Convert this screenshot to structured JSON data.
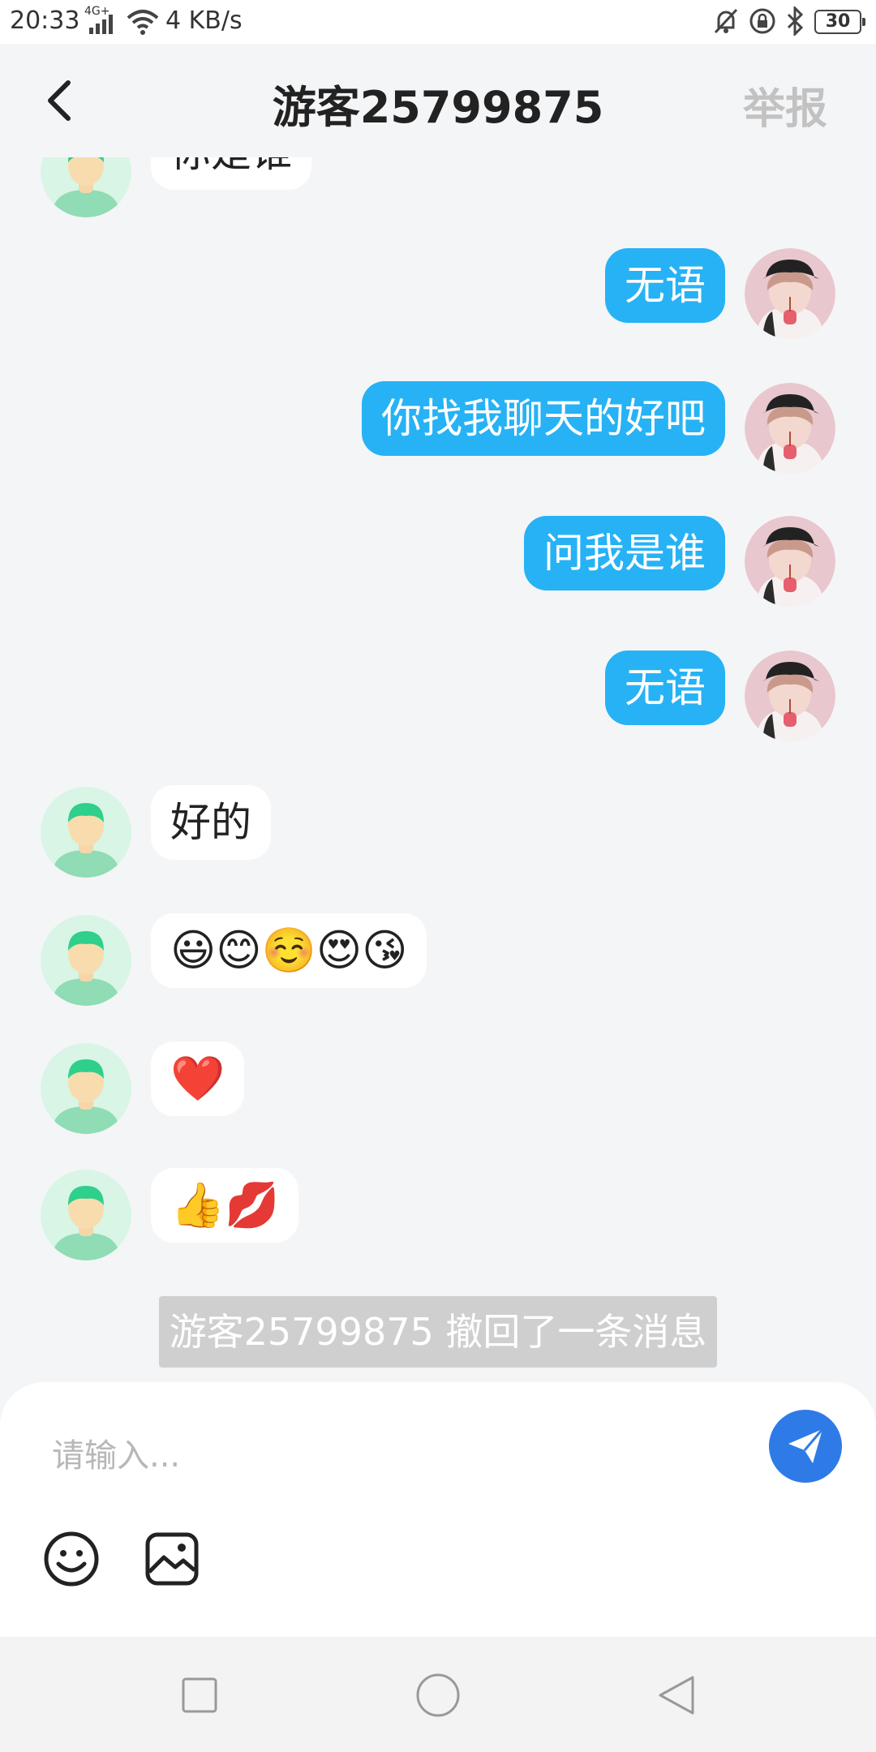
{
  "status_bar": {
    "time": "20:33",
    "network_type": "4G+",
    "speed": "4 KB/s",
    "battery": "30",
    "icons": [
      "signal-icon",
      "wifi-icon",
      "bell-mute-icon",
      "lock-icon",
      "bluetooth-icon",
      "battery-icon"
    ]
  },
  "header": {
    "title": "游客25799875",
    "report_label": "举报",
    "back_icon": "chevron-left-icon"
  },
  "messages": [
    {
      "side": "in",
      "text": "你是谁",
      "partial": true
    },
    {
      "side": "out",
      "text": "无语"
    },
    {
      "side": "out",
      "text": "你找我聊天的好吧"
    },
    {
      "side": "out",
      "text": "问我是谁"
    },
    {
      "side": "out",
      "text": "无语"
    },
    {
      "side": "in",
      "text": "好的"
    },
    {
      "side": "in",
      "text": "😃😊☺️😍😘"
    },
    {
      "side": "in",
      "text": "❤️"
    },
    {
      "side": "in",
      "text": "👍💋"
    }
  ],
  "recall_notice": "游客25799875 撤回了一条消息",
  "composer": {
    "placeholder": "请输入...",
    "send_icon": "send-icon",
    "tools": [
      "emoji-icon",
      "image-icon"
    ]
  },
  "colors": {
    "outgoing_bubble": "#27b2f5",
    "incoming_bubble": "#ffffff",
    "send_button": "#2e7be8",
    "background": "#f4f5f7"
  }
}
